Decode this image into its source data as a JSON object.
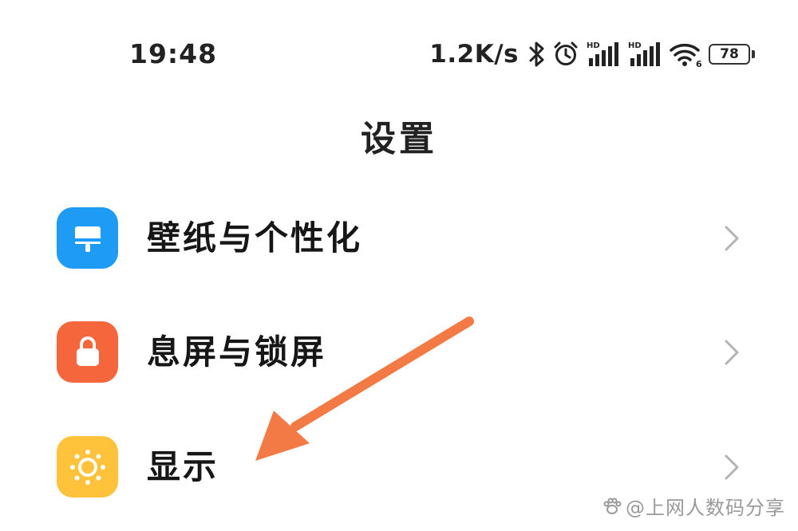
{
  "status_bar": {
    "time": "19:48",
    "net_speed": "1.2K/s",
    "icons": [
      "bluetooth-icon",
      "alarm-icon",
      "signal-hd-icon",
      "signal-hd-icon",
      "wifi-icon"
    ],
    "signal_badge_1": "HD",
    "signal_badge_2": "HD",
    "wifi_badge": "6",
    "battery": "78"
  },
  "header": {
    "title": "设置"
  },
  "settings": {
    "items": [
      {
        "label": "壁纸与个性化",
        "icon": "wallpaper-brush-icon",
        "icon_color": "#1E9BF5"
      },
      {
        "label": "息屏与锁屏",
        "icon": "lock-icon",
        "icon_color": "#F5663C"
      },
      {
        "label": "显示",
        "icon": "sun-icon",
        "icon_color": "#FFC23A"
      }
    ]
  },
  "annotation": {
    "arrow_color": "#F47A45",
    "arrow_icon": "pointer-arrow-icon"
  },
  "watermark": {
    "text": "@上网人数码分享",
    "icon": "paw-icon"
  }
}
